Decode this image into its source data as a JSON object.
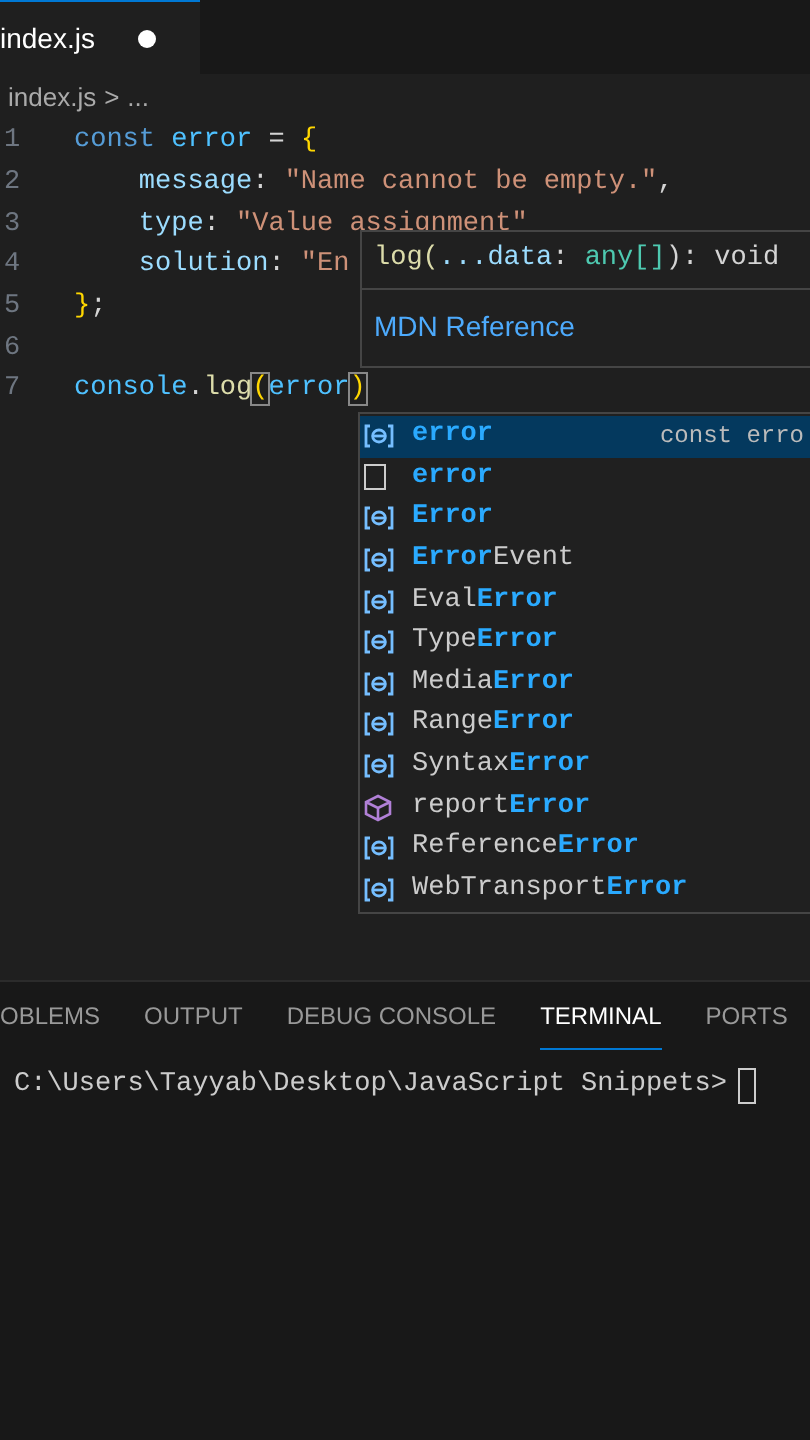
{
  "tab": {
    "label": "index.js",
    "modified": true
  },
  "breadcrumb": {
    "file": "index.js",
    "separator": ">",
    "rest": "..."
  },
  "code_lines": [
    {
      "number": "1",
      "tokens": [
        {
          "kind": "keyword",
          "text": "const "
        },
        {
          "kind": "variable",
          "text": "error"
        },
        {
          "kind": "punct",
          "text": " = "
        },
        {
          "kind": "brace",
          "text": "{"
        }
      ]
    },
    {
      "number": "2",
      "indented": true,
      "tokens": [
        {
          "kind": "property",
          "text": "message"
        },
        {
          "kind": "punct",
          "text": ": "
        },
        {
          "kind": "string",
          "text": "\"Name cannot be empty.\""
        },
        {
          "kind": "punct",
          "text": ","
        }
      ]
    },
    {
      "number": "3",
      "indented": true,
      "tokens": [
        {
          "kind": "property",
          "text": "type"
        },
        {
          "kind": "punct",
          "text": ": "
        },
        {
          "kind": "string",
          "text": "\"Value assignment\""
        }
      ]
    },
    {
      "number": "4",
      "indented": true,
      "tokens": [
        {
          "kind": "property",
          "text": "solution"
        },
        {
          "kind": "punct",
          "text": ": "
        },
        {
          "kind": "string",
          "text": "\"En"
        }
      ]
    },
    {
      "number": "5",
      "tokens": [
        {
          "kind": "brace",
          "text": "}"
        },
        {
          "kind": "punct",
          "text": ";"
        }
      ]
    },
    {
      "number": "6"
    },
    {
      "number": "7",
      "tokens": [
        {
          "kind": "variable",
          "text": "console"
        },
        {
          "kind": "punct",
          "text": "."
        },
        {
          "kind": "function",
          "text": "log"
        },
        {
          "kind": "bracket",
          "text": "("
        },
        {
          "kind": "variable",
          "text": "error"
        },
        {
          "kind": "bracket",
          "text": ")"
        }
      ]
    }
  ],
  "hover": {
    "signature": [
      {
        "kind": "function",
        "text": "log("
      },
      {
        "kind": "param",
        "text": "...data"
      },
      {
        "kind": "punct",
        "text": ": "
      },
      {
        "kind": "type",
        "text": "any[]"
      },
      {
        "kind": "punct",
        "text": "): void"
      }
    ],
    "link": "MDN Reference"
  },
  "suggestions": [
    {
      "kind": "variable",
      "selected": true,
      "parts": [
        {
          "text": "error",
          "match": true
        }
      ],
      "detail": "const erro"
    },
    {
      "kind": "word",
      "selected": false,
      "parts": [
        {
          "text": "error",
          "match": true
        }
      ]
    },
    {
      "kind": "variable",
      "selected": false,
      "parts": [
        {
          "text": "Error",
          "match": true
        }
      ]
    },
    {
      "kind": "variable",
      "selected": false,
      "parts": [
        {
          "text": "Error",
          "match": true
        },
        {
          "text": "Event",
          "match": false
        }
      ]
    },
    {
      "kind": "variable",
      "selected": false,
      "parts": [
        {
          "text": "Eval",
          "match": false
        },
        {
          "text": "Error",
          "match": true
        }
      ]
    },
    {
      "kind": "variable",
      "selected": false,
      "parts": [
        {
          "text": "Type",
          "match": false
        },
        {
          "text": "Error",
          "match": true
        }
      ]
    },
    {
      "kind": "variable",
      "selected": false,
      "parts": [
        {
          "text": "Media",
          "match": false
        },
        {
          "text": "Error",
          "match": true
        }
      ]
    },
    {
      "kind": "variable",
      "selected": false,
      "parts": [
        {
          "text": "Range",
          "match": false
        },
        {
          "text": "Error",
          "match": true
        }
      ]
    },
    {
      "kind": "variable",
      "selected": false,
      "parts": [
        {
          "text": "Syntax",
          "match": false
        },
        {
          "text": "Error",
          "match": true
        }
      ]
    },
    {
      "kind": "method",
      "selected": false,
      "parts": [
        {
          "text": "report",
          "match": false
        },
        {
          "text": "Error",
          "match": true
        }
      ]
    },
    {
      "kind": "variable",
      "selected": false,
      "parts": [
        {
          "text": "Reference",
          "match": false
        },
        {
          "text": "Error",
          "match": true
        }
      ]
    },
    {
      "kind": "variable",
      "selected": false,
      "parts": [
        {
          "text": "WebTransport",
          "match": false
        },
        {
          "text": "Error",
          "match": true
        }
      ]
    }
  ],
  "panel_tabs": [
    {
      "label": "OBLEMS",
      "selected": false
    },
    {
      "label": "OUTPUT",
      "selected": false
    },
    {
      "label": "DEBUG CONSOLE",
      "selected": false
    },
    {
      "label": "TERMINAL",
      "selected": true
    },
    {
      "label": "PORTS",
      "selected": false
    }
  ],
  "terminal": {
    "prompt": "C:\\Users\\Tayyab\\Desktop\\JavaScript Snippets>"
  }
}
